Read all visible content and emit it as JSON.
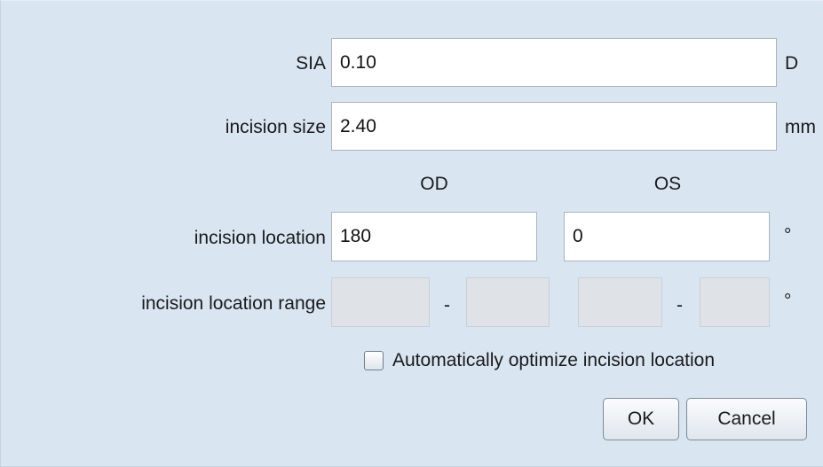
{
  "form": {
    "sia": {
      "label": "SIA",
      "value": "0.10",
      "unit": "D"
    },
    "incision_size": {
      "label": "incision size",
      "value": "2.40",
      "unit": "mm"
    },
    "columns": {
      "od": "OD",
      "os": "OS"
    },
    "incision_location": {
      "label": "incision location",
      "od_value": "180",
      "os_value": "0",
      "unit": "°"
    },
    "incision_location_range": {
      "label": "incision location range",
      "od_from": "",
      "od_to": "",
      "os_from": "",
      "os_to": "",
      "separator": "-",
      "unit": "°"
    },
    "auto_optimize": {
      "label": "Automatically optimize incision location",
      "checked": false
    }
  },
  "buttons": {
    "ok": "OK",
    "cancel": "Cancel"
  }
}
